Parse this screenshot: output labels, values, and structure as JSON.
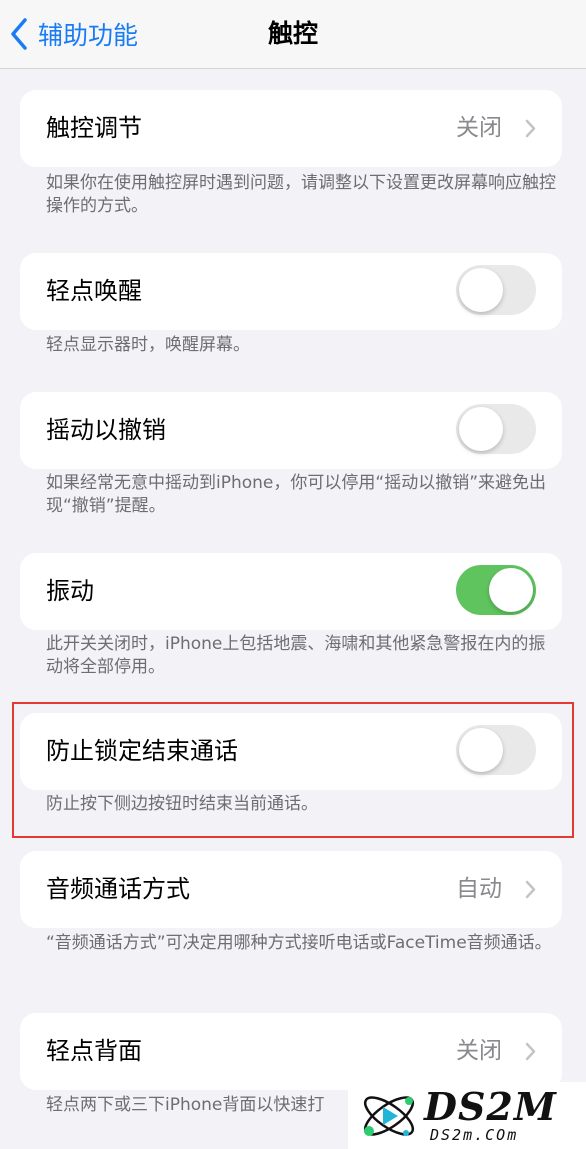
{
  "nav": {
    "back_label": "辅助功能",
    "title": "触控"
  },
  "settings": [
    {
      "label": "触控调节",
      "value": "关闭",
      "footnote": "如果你在使用触控屏时遇到问题，请调整以下设置更改屏幕响应触控操作的方式。"
    },
    {
      "label": "轻点唤醒",
      "toggle": false,
      "footnote": "轻点显示器时，唤醒屏幕。"
    },
    {
      "label": "摇动以撤销",
      "toggle": false,
      "footnote": "如果经常无意中摇动到iPhone，你可以停用“摇动以撤销”来避免出现“撤销”提醒。"
    },
    {
      "label": "振动",
      "toggle": true,
      "footnote": "此开关关闭时，iPhone上包括地震、海啸和其他紧急警报在内的振动将全部停用。"
    },
    {
      "label": "防止锁定结束通话",
      "toggle": false,
      "footnote": "防止按下侧边按钮时结束当前通话。"
    },
    {
      "label": "音频通话方式",
      "value": "自动",
      "footnote": "“音频通话方式”可决定用哪种方式接听电话或FaceTime音频通话。"
    },
    {
      "label": "轻点背面",
      "value": "关闭",
      "footnote": "轻点两下或三下iPhone背面以快速打"
    }
  ],
  "colors": {
    "accent": "#1a7cf5",
    "toggle_on": "#5fc45e",
    "highlight": "#e53935"
  },
  "watermark": {
    "main": "DS2M",
    "sub": "DS2m.COm"
  }
}
